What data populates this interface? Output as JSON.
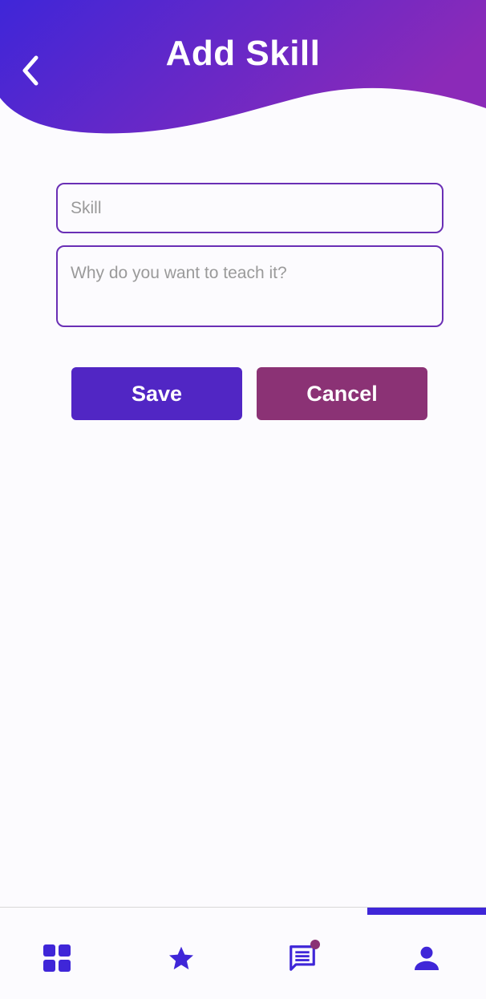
{
  "header": {
    "title": "Add Skill",
    "back_icon": "chevron-left-icon",
    "gradient_start": "#3f26d8",
    "gradient_end": "#8b2ab8"
  },
  "form": {
    "skill_placeholder": "Skill",
    "skill_value": "",
    "reason_placeholder": "Why do you want to teach it?",
    "reason_value": "",
    "border_color": "#6a2fb5"
  },
  "actions": {
    "save_label": "Save",
    "cancel_label": "Cancel",
    "save_color": "#5126c4",
    "cancel_color": "#8b3275"
  },
  "bottom_nav": {
    "items": [
      {
        "name": "home",
        "icon": "grid-icon"
      },
      {
        "name": "favorites",
        "icon": "star-icon"
      },
      {
        "name": "messages",
        "icon": "message-icon",
        "has_notification": true
      },
      {
        "name": "profile",
        "icon": "person-icon",
        "active": true
      }
    ],
    "accent_color": "#3f26d8",
    "notification_color": "#8b3275"
  }
}
